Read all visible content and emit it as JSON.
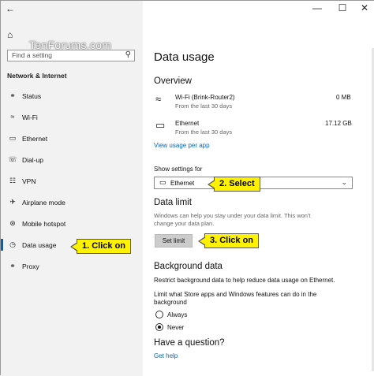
{
  "titlebar": {
    "back_icon": "back-arrow-icon",
    "minimize": "—",
    "maximize": "☐",
    "close": "✕"
  },
  "watermark": "TenForums.com",
  "sidebar": {
    "home_icon": "home-icon",
    "search_placeholder": "Find a setting",
    "section": "Network & Internet",
    "items": [
      {
        "label": "Status",
        "icon": "globe-icon"
      },
      {
        "label": "Wi-Fi",
        "icon": "wifi-icon"
      },
      {
        "label": "Ethernet",
        "icon": "ethernet-icon"
      },
      {
        "label": "Dial-up",
        "icon": "phone-icon"
      },
      {
        "label": "VPN",
        "icon": "vpn-icon"
      },
      {
        "label": "Airplane mode",
        "icon": "airplane-icon"
      },
      {
        "label": "Mobile hotspot",
        "icon": "hotspot-icon"
      },
      {
        "label": "Data usage",
        "icon": "data-usage-icon",
        "selected": true
      },
      {
        "label": "Proxy",
        "icon": "globe-icon"
      }
    ]
  },
  "main": {
    "title": "Data usage",
    "overview": {
      "heading": "Overview",
      "rows": [
        {
          "name": "Wi-Fi (Brink-Router2)",
          "sub": "From the last 30 days",
          "value": "0 MB"
        },
        {
          "name": "Ethernet",
          "sub": "From the last 30 days",
          "value": "17.12 GB"
        }
      ],
      "link": "View usage per app"
    },
    "show_settings_label": "Show settings for",
    "dropdown_value": "Ethernet",
    "data_limit": {
      "heading": "Data limit",
      "desc1": "Windows can help you stay under your data limit. This won't",
      "desc2": "change your data plan.",
      "button": "Set limit"
    },
    "background": {
      "heading": "Background data",
      "desc": "Restrict background data to help reduce data usage on Ethernet.",
      "q1": "Limit what Store apps and Windows features can do in the",
      "q2": "background",
      "options": [
        {
          "label": "Always",
          "checked": false
        },
        {
          "label": "Never",
          "checked": true
        }
      ]
    },
    "question": {
      "heading": "Have a question?",
      "link": "Get help"
    }
  },
  "callouts": [
    "1. Click on",
    "2. Select",
    "3. Click on"
  ],
  "colors": {
    "accent": "#0063b1",
    "callout": "#fff200",
    "link": "#0067b8",
    "sidebar_bg": "#f2f2f2"
  }
}
